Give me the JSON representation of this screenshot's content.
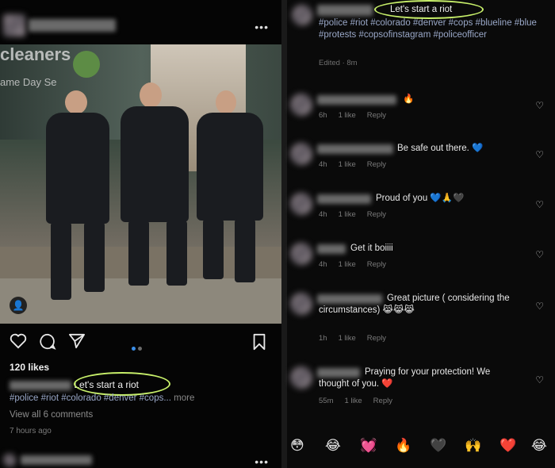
{
  "left_post": {
    "more_icon": "more-horizontal-icon",
    "photo_sign": {
      "line1": "cleaners",
      "line2": "ame Day Se"
    },
    "actions": {
      "like_icon": "heart-outline-icon",
      "comment_icon": "comment-outline-icon",
      "share_icon": "paper-plane-icon",
      "save_icon": "bookmark-outline-icon",
      "tag_icon": "person-tag-icon"
    },
    "likes": "120 likes",
    "caption": "Let's start a riot",
    "hashtags": "#police #riot #colorado #denver #cops...",
    "more_label": "more",
    "view_all_comments": "View all 6 comments",
    "time_ago": "7 hours ago"
  },
  "right_post": {
    "caption": "Let's start a riot",
    "hashtags": "#police #riot #colorado #denver #cops #blueline #blue #protests #copsofinstagram #policeofficer",
    "edited": "Edited · 8m",
    "comments": [
      {
        "text": "🔥",
        "time": "6h",
        "likes": "1 like",
        "reply": "Reply"
      },
      {
        "text": "Be safe out there. 💙",
        "time": "4h",
        "likes": "1 like",
        "reply": "Reply"
      },
      {
        "text": "Proud of you 💙🙏🖤",
        "time": "4h",
        "likes": "1 like",
        "reply": "Reply"
      },
      {
        "text": "Get it boiiii",
        "time": "4h",
        "likes": "1 like",
        "reply": "Reply"
      },
      {
        "text": "Great picture ( considering the circumstances) 😹😹😹",
        "time": "1h",
        "likes": "1 like",
        "reply": "Reply"
      },
      {
        "text": "Praying for your protection! We thought of you. ❤️",
        "time": "55m",
        "likes": "1 like",
        "reply": "Reply"
      }
    ],
    "emoji_bar": [
      "😳",
      "😂",
      "💓",
      "🔥",
      "🖤",
      "🙌",
      "❤️",
      "😂"
    ],
    "like_icon": "heart-outline-icon"
  },
  "colors": {
    "highlight": "#c8f06a",
    "hashtag": "#9aa8c8",
    "pager_active": "#3a8ee8"
  }
}
